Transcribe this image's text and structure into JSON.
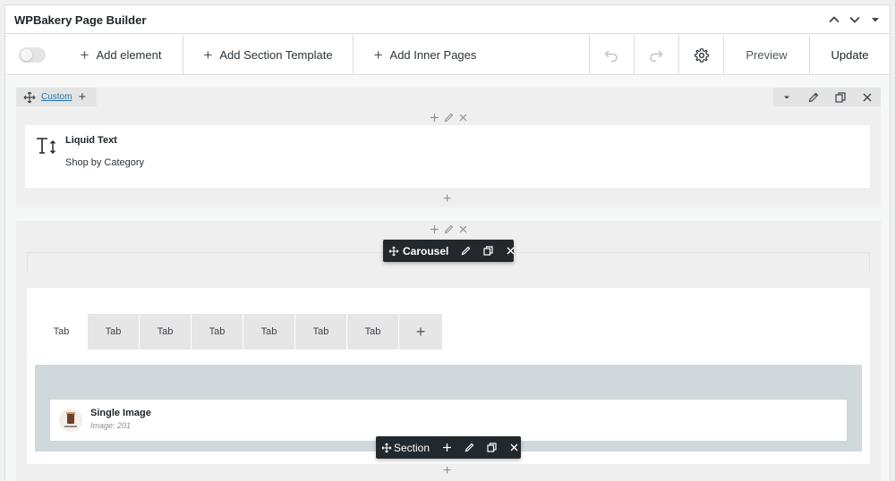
{
  "header": {
    "title": "WPBakery Page Builder",
    "collapse_icon": "chevron-up-icon",
    "expand_icon": "chevron-down-icon"
  },
  "toolbar": {
    "add_element": "Add element",
    "add_section_template": "Add Section Template",
    "add_inner_pages": "Add Inner Pages",
    "preview": "Preview",
    "update": "Update",
    "toggle_on": false
  },
  "row1": {
    "tab_label": "Custom",
    "element": {
      "title": "Liquid Text",
      "subtitle": "Shop by Category",
      "icon": "text-size-icon"
    }
  },
  "row2": {
    "carousel_label": "Carousel",
    "tabs": [
      "Tab",
      "Tab",
      "Tab",
      "Tab",
      "Tab",
      "Tab",
      "Tab"
    ],
    "active_tab_index": 0,
    "section_label": "Section",
    "image_element": {
      "title": "Single Image",
      "subtitle": "Image: 201"
    }
  },
  "colors": {
    "link": "#2271b1",
    "dark_toolbar": "#23282d",
    "section_bg": "#d0d8dc"
  }
}
